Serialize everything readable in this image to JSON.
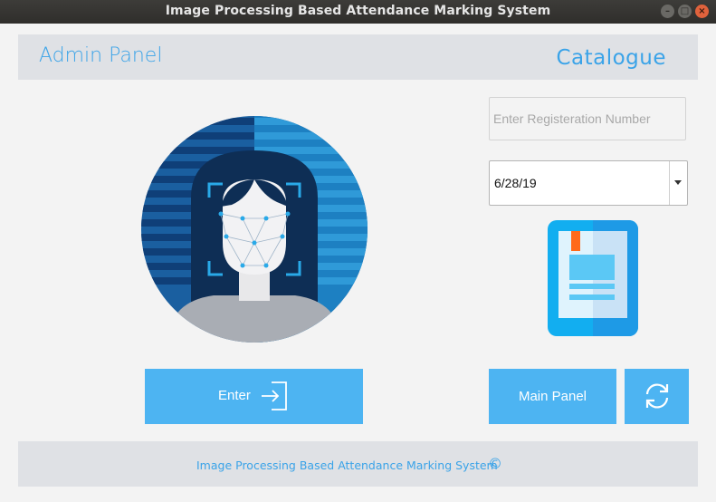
{
  "window": {
    "title": "Image Processing Based Attendance Marking System",
    "buttons": [
      "–",
      "□",
      "×"
    ]
  },
  "header": {
    "left": "Admin Panel",
    "right": "Catalogue"
  },
  "form": {
    "registration": {
      "placeholder": "Enter Registeration Number",
      "value": ""
    },
    "date": {
      "value": "6/28/19"
    }
  },
  "icons": {
    "face": "face-recognition-icon",
    "catalog": "id-card-icon",
    "enter": "enter-icon",
    "refresh": "refresh-icon"
  },
  "buttons": {
    "enter": "Enter",
    "main_panel": "Main Panel"
  },
  "footer": {
    "text": "Image Processing Based Attendance Marking System",
    "symbol": "©"
  },
  "colors": {
    "accent": "#4db4f2",
    "text_accent": "#3aa3e8",
    "panel": "#dfe1e5"
  }
}
